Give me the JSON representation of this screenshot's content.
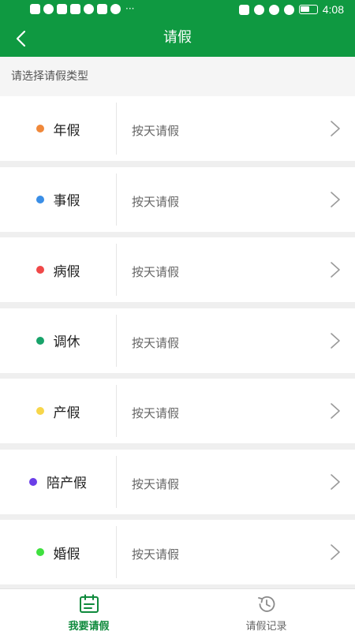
{
  "status_bar": {
    "time": "4:08",
    "more": "···"
  },
  "header": {
    "title": "请假",
    "back_icon": "chevron-left-icon"
  },
  "subtitle": "请选择请假类型",
  "leave_types": [
    {
      "label": "年假",
      "desc": "按天请假",
      "color": "#f0883a"
    },
    {
      "label": "事假",
      "desc": "按天请假",
      "color": "#3a8ee6"
    },
    {
      "label": "病假",
      "desc": "按天请假",
      "color": "#f04848"
    },
    {
      "label": "调休",
      "desc": "按天请假",
      "color": "#18a36a"
    },
    {
      "label": "产假",
      "desc": "按天请假",
      "color": "#f7d64a"
    },
    {
      "label": "陪产假",
      "desc": "按天请假",
      "color": "#6a3ee8"
    },
    {
      "label": "婚假",
      "desc": "按天请假",
      "color": "#3fe03f"
    }
  ],
  "tabbar": {
    "tabs": [
      {
        "label": "我要请假",
        "icon": "calendar-icon",
        "active": true
      },
      {
        "label": "请假记录",
        "icon": "history-clock-icon",
        "active": false
      }
    ],
    "active_color": "#0f8a3c",
    "inactive_color": "#666666"
  },
  "colors": {
    "brand": "#0f9941"
  }
}
